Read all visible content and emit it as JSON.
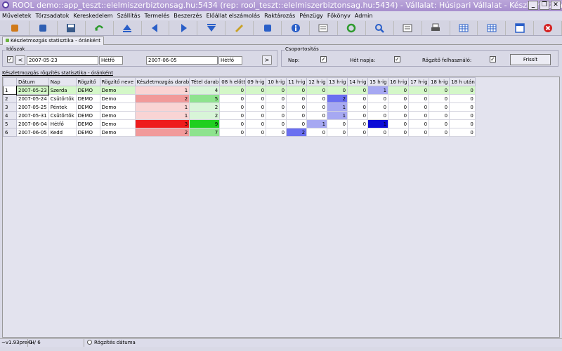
{
  "window": {
    "title": "ROOL demo::app_teszt::elelmiszerbiztonsag.hu:5434 (rep: rool_teszt::elelmiszerbiztonsag.hu:5434) - Vállalat: Húsipari Vállalat - Készletmozgás",
    "buttons": [
      "_",
      "❐",
      "✕"
    ]
  },
  "menu": [
    "Műveletek",
    "Törzsadatok",
    "Kereskedelem",
    "Szállítás",
    "Termelés",
    "Beszerzés",
    "Előállat elszámolás",
    "Raktározás",
    "Pénzügy",
    "Főkönyv",
    "Admin"
  ],
  "toolbar": [
    {
      "icon": "import-icon",
      "color": "#d07a1a"
    },
    {
      "icon": "open-icon",
      "color": "#2f5fb3"
    },
    {
      "icon": "save-icon",
      "color": "#3a5b8a"
    },
    {
      "icon": "undo-icon",
      "color": "#2e9b2e"
    },
    {
      "icon": "first-record-icon",
      "color": "#2a5fc8"
    },
    {
      "icon": "previous-record-icon",
      "color": "#2a5fc8"
    },
    {
      "icon": "next-record-icon",
      "color": "#2a5fc8"
    },
    {
      "icon": "last-record-icon",
      "color": "#2a5fc8"
    },
    {
      "icon": "edit-icon",
      "color": "#c9a227"
    },
    {
      "icon": "document-icon",
      "color": "#2a5fc8"
    },
    {
      "icon": "info-icon",
      "color": "#2a5fc8"
    },
    {
      "icon": "form-icon",
      "color": "#666666"
    },
    {
      "icon": "refresh-icon",
      "color": "#2e9b2e"
    },
    {
      "icon": "search-icon",
      "color": "#2a5fc8"
    },
    {
      "icon": "list-icon",
      "color": "#555555"
    },
    {
      "icon": "print-icon",
      "color": "#555555"
    },
    {
      "icon": "grid-icon",
      "color": "#2a5fc8"
    },
    {
      "icon": "columns-icon",
      "color": "#2a5fc8"
    },
    {
      "icon": "window-icon",
      "color": "#2a5fc8"
    },
    {
      "icon": "close-icon",
      "color": "#d42020"
    }
  ],
  "tab": {
    "label": "Készletmozgás statisztika - óránként"
  },
  "period": {
    "legend": "Időszak",
    "checked": "✓",
    "prev_arrow": "<",
    "next_arrow": ">",
    "from_date": "2007-05-23",
    "from_day": "Hétfő",
    "to_date": "2007-06-05",
    "to_day": "Hétfő"
  },
  "grouping": {
    "legend": "Csoportosítás",
    "nap_label": "Nap:",
    "hetnapja_label": "Hét napja:",
    "rogzito_label": "Rögzítő felhasználó:",
    "check_mark": "✓",
    "refresh_button": "Frissít"
  },
  "grid": {
    "title": "Készletmozgás rögzítés statisztika - óránként",
    "columns": [
      "Dátum",
      "Nap",
      "Rögzítő",
      "Rögzítő neve",
      "Készletmozgás darab",
      "Tétel darab",
      "08 h előtt",
      "09 h-ig",
      "10 h-ig",
      "11 h-ig",
      "12 h-ig",
      "13 h-ig",
      "14 h-ig",
      "15 h-ig",
      "16 h-ig",
      "17 h-ig",
      "18 h-ig",
      "18 h után"
    ],
    "rows": [
      {
        "n": "1",
        "date": "2007-05-23",
        "day": "Szerda",
        "user": "DEMO",
        "name": "Demo",
        "km": "1",
        "tetel": "4",
        "h": [
          "0",
          "0",
          "0",
          "0",
          "0",
          "0",
          "0",
          "1",
          "0",
          "0",
          "0",
          "0"
        ]
      },
      {
        "n": "2",
        "date": "2007-05-24",
        "day": "Csütörtök",
        "user": "DEMO",
        "name": "Demo",
        "km": "2",
        "tetel": "5",
        "h": [
          "0",
          "0",
          "0",
          "0",
          "0",
          "2",
          "0",
          "0",
          "0",
          "0",
          "0",
          "0"
        ]
      },
      {
        "n": "3",
        "date": "2007-05-25",
        "day": "Péntek",
        "user": "DEMO",
        "name": "Demo",
        "km": "1",
        "tetel": "2",
        "h": [
          "0",
          "0",
          "0",
          "0",
          "0",
          "1",
          "0",
          "0",
          "0",
          "0",
          "0",
          "0"
        ]
      },
      {
        "n": "4",
        "date": "2007-05-31",
        "day": "Csütörtök",
        "user": "DEMO",
        "name": "Demo",
        "km": "1",
        "tetel": "2",
        "h": [
          "0",
          "0",
          "0",
          "0",
          "0",
          "1",
          "0",
          "0",
          "0",
          "0",
          "0",
          "0"
        ]
      },
      {
        "n": "5",
        "date": "2007-06-04",
        "day": "Hétfő",
        "user": "DEMO",
        "name": "Demo",
        "km": "3",
        "tetel": "9",
        "h": [
          "0",
          "0",
          "0",
          "0",
          "1",
          "0",
          "0",
          "1",
          "0",
          "0",
          "0",
          "0"
        ]
      },
      {
        "n": "6",
        "date": "2007-06-05",
        "day": "Kedd",
        "user": "DEMO",
        "name": "Demo",
        "km": "2",
        "tetel": "7",
        "h": [
          "0",
          "0",
          "0",
          "2",
          "0",
          "0",
          "0",
          "0",
          "0",
          "0",
          "0",
          "0"
        ]
      }
    ]
  },
  "status": {
    "version": "~v1.93pre4H",
    "record": "1 / 6",
    "radio_label": "Rögzítés dátuma"
  },
  "colors": {
    "selected_row": "#d4f7c8",
    "km_low": "#f9d4d4",
    "km_mid": "#f19a9a",
    "km_high": "#ee1c1c",
    "tetel_low": "#d8f5d8",
    "tetel_mid": "#8ee38e",
    "tetel_high": "#1fcf1f",
    "hour_low": "#a6a8f2",
    "hour_mid": "#6a6ff0",
    "hour_high": "#0b0bd6"
  }
}
